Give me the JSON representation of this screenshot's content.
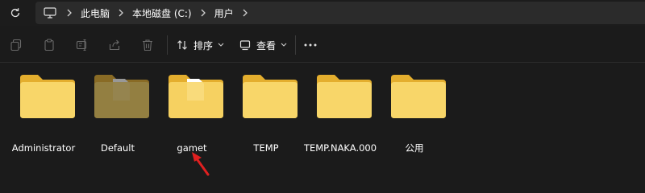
{
  "address_bar": {
    "refresh_icon": "refresh-icon",
    "root_icon": "monitor-icon",
    "crumbs": [
      {
        "label": "此电脑"
      },
      {
        "label": "本地磁盘 (C:)"
      },
      {
        "label": "用户"
      }
    ],
    "separator_icon": "chevron-right-icon"
  },
  "toolbar": {
    "icons": [
      "copy-icon",
      "paste-icon",
      "rename-icon",
      "share-icon",
      "delete-icon"
    ],
    "sort_label": "排序",
    "view_label": "查看",
    "more_icon": "ellipsis-icon"
  },
  "folders": [
    {
      "name": "Administrator"
    },
    {
      "name": "Default"
    },
    {
      "name": "gamet"
    },
    {
      "name": "TEMP"
    },
    {
      "name": "TEMP.NAKA.000"
    },
    {
      "name": "公用"
    }
  ],
  "annotation": {
    "icon": "red-arrow-icon",
    "color": "#e02020"
  },
  "colors": {
    "background": "#1b1b1b",
    "folder_front": "#f8d669",
    "folder_back": "#e4ae2e"
  }
}
